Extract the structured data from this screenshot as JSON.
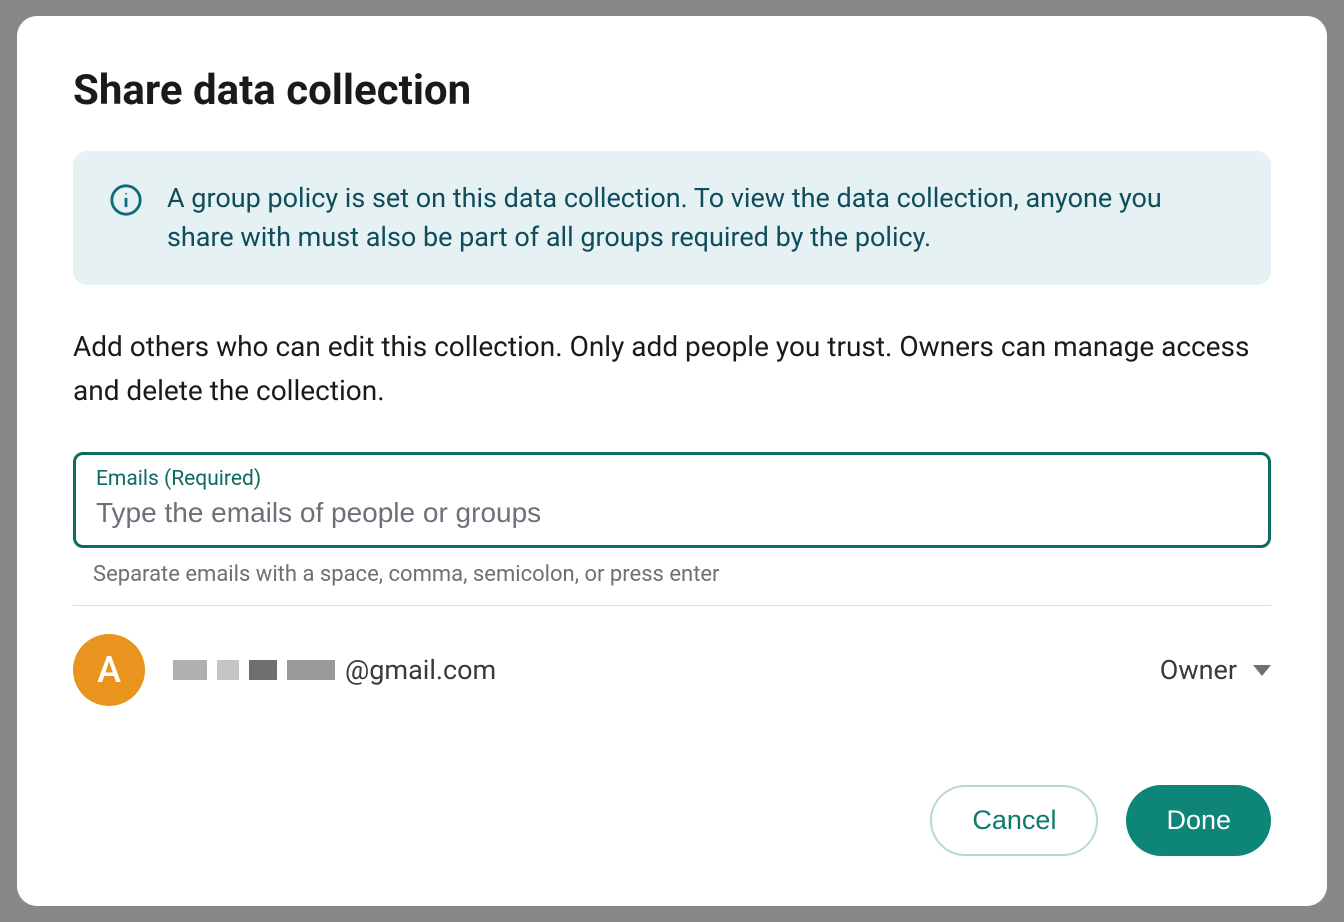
{
  "modal": {
    "title": "Share data collection",
    "info_text": "A group policy is set on this data collection. To view the data collection, anyone you share with must also be part of all groups required by the policy.",
    "description": "Add others who can edit this collection. Only add people you trust. Owners can manage access and delete the collection.",
    "email_label": "Emails (Required)",
    "email_placeholder": "Type the emails of people or groups",
    "email_value": "",
    "helper_text": "Separate emails with a space, comma, semicolon, or press enter",
    "user": {
      "avatar_initial": "A",
      "email_suffix": "@gmail.com",
      "role": "Owner"
    },
    "cancel_label": "Cancel",
    "done_label": "Done"
  }
}
